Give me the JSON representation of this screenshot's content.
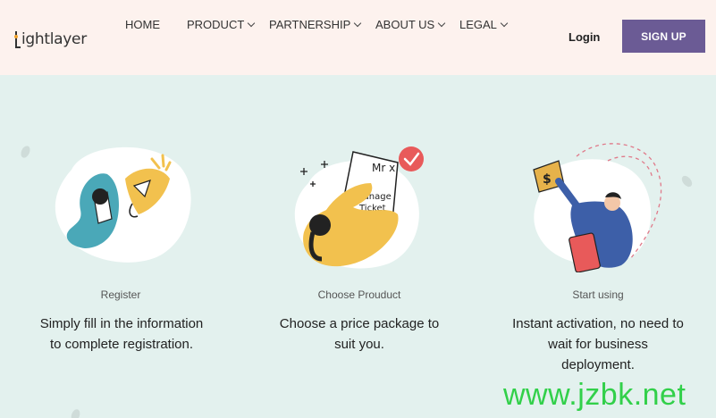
{
  "header": {
    "logo_text": "ightlayer",
    "nav": [
      {
        "label": "HOME",
        "has_dropdown": false
      },
      {
        "label": "PRODUCT",
        "has_dropdown": true
      },
      {
        "label": "PARTNERSHIP",
        "has_dropdown": true
      },
      {
        "label": "ABOUT US",
        "has_dropdown": true
      },
      {
        "label": "LEGAL",
        "has_dropdown": true
      }
    ],
    "login_label": "Login",
    "signup_label": "SIGN UP"
  },
  "steps": [
    {
      "label": "Register",
      "description_lines": [
        "Simply fill in the information",
        "to complete registration."
      ]
    },
    {
      "label": "Choose Prouduct",
      "description_lines": [
        "Choose a price package to",
        "suit you."
      ],
      "ticket_lines": [
        "Mr x",
        "Manage",
        "Ticket"
      ]
    },
    {
      "label": "Start using",
      "description_lines": [
        "Instant activation, no need to",
        "wait for business",
        "deployment."
      ]
    }
  ],
  "watermark": "www.jzbk.net",
  "colors": {
    "header_bg": "#fdf2ee",
    "page_bg": "#e3f1ee",
    "signup_bg": "#6b5b95",
    "teal": "#4aa8b8",
    "yellow": "#f2c14e",
    "blue": "#3d5fa8",
    "red": "#e85a5a",
    "watermark": "#32d04a"
  }
}
